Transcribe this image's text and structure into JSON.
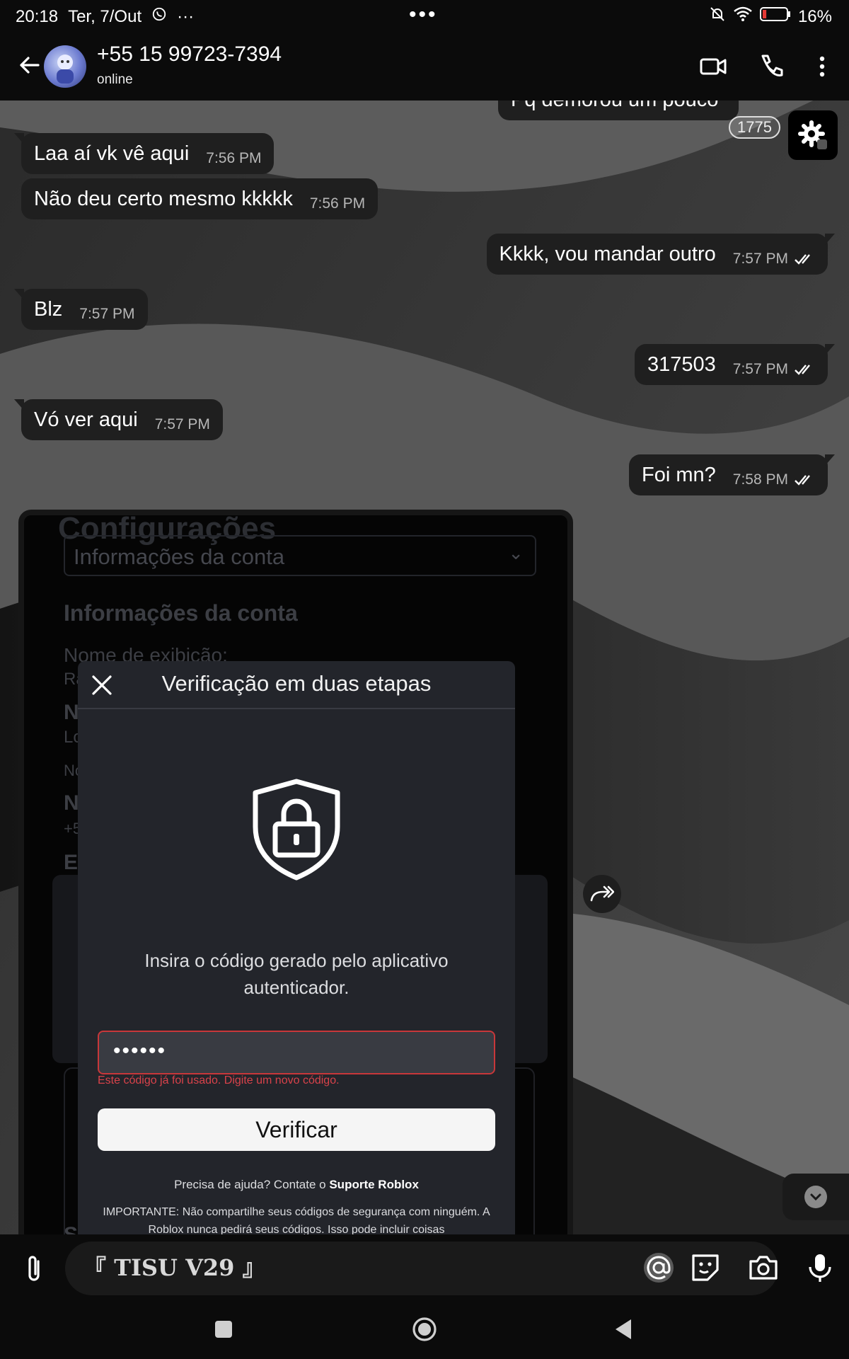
{
  "status_bar": {
    "time": "20:18",
    "date": "Ter, 7/Out",
    "more": "···",
    "center_dots": "•••",
    "battery": "16%",
    "battery_level": 0.16
  },
  "header": {
    "contact_name": "+55 15 99723-7394",
    "status": "online"
  },
  "chat": {
    "counter": "1775",
    "partial_message": "Pq demorou um pouco",
    "messages": [
      {
        "direction": "in",
        "text": "Laa aí vk vê aqui",
        "time": "7:56 PM"
      },
      {
        "direction": "in",
        "text": "Não deu certo mesmo kkkkk",
        "time": "7:56 PM"
      },
      {
        "direction": "out",
        "text": "Kkkk, vou mandar outro",
        "time": "7:57 PM",
        "read": true
      },
      {
        "direction": "in",
        "text": "Blz",
        "time": "7:57 PM"
      },
      {
        "direction": "out",
        "text": "317503",
        "time": "7:57 PM",
        "read": true
      },
      {
        "direction": "in",
        "text": "Vó ver aqui",
        "time": "7:57 PM"
      },
      {
        "direction": "out",
        "text": "Foi mn?",
        "time": "7:58 PM",
        "read": true
      }
    ]
  },
  "screenshot_image": {
    "page_title": "Configurações",
    "dropdown_value": "Informações da conta",
    "section_title": "Informações da conta",
    "display_name_label": "Nome de exibição:",
    "partial_lines": [
      "Ra",
      "No",
      "Lo",
      "No",
      "Nu",
      "+5",
      "Em",
      "Se"
    ],
    "modal": {
      "title": "Verificação em duas etapas",
      "description": "Insira o código gerado pelo aplicativo autenticador.",
      "code_value": "••••••",
      "error": "Este código já foi usado. Digite um novo código.",
      "verify_button": "Verificar",
      "help_prefix": "Precisa de ajuda? Contate o ",
      "help_link": "Suporte Roblox",
      "important": "IMPORTANTE: Não compartilhe seus códigos de segurança com ninguém. A Roblox nunca pedirá seus códigos. Isso pode incluir coisas"
    }
  },
  "input_bar": {
    "draft_text": "『 TISU V29 』"
  },
  "colors": {
    "bubble": "#1f1f1f",
    "modal_bg": "#23252b",
    "error": "#d9424a",
    "background": "#0b0b0b"
  },
  "icons": [
    "back-arrow-icon",
    "video-call-icon",
    "phone-icon",
    "more-vert-icon",
    "settings-gear-icon",
    "lock-shield-icon",
    "close-icon",
    "double-check-icon",
    "forward-icon",
    "chevron-down-icon",
    "paperclip-icon",
    "mention-icon",
    "sticker-icon",
    "camera-icon",
    "microphone-icon"
  ]
}
